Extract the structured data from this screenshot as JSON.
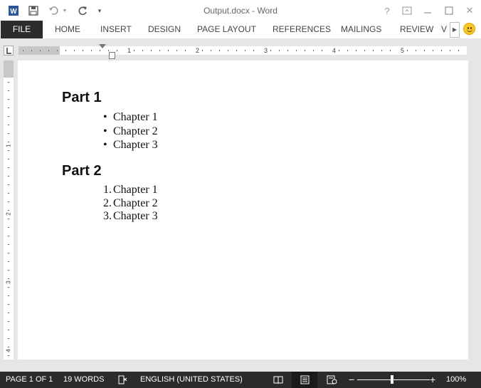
{
  "window": {
    "title": "Output.docx - Word",
    "help_label": "?",
    "minimize_label": "—",
    "close_label": "✕"
  },
  "quick_access": {
    "word_icon": "word-icon",
    "save_icon": "save-icon",
    "undo_icon": "undo-icon",
    "redo_icon": "redo-icon",
    "customize_icon": "customize-icon"
  },
  "ribbon": {
    "tabs": [
      {
        "label": "FILE"
      },
      {
        "label": "HOME"
      },
      {
        "label": "INSERT"
      },
      {
        "label": "DESIGN"
      },
      {
        "label": "PAGE LAYOUT"
      },
      {
        "label": "REFERENCES"
      },
      {
        "label": "MAILINGS"
      },
      {
        "label": "REVIEW"
      },
      {
        "label": "V"
      }
    ]
  },
  "ruler": {
    "h_numbers": [
      "1",
      "2",
      "3",
      "4",
      "5"
    ],
    "v_numbers": [
      "1",
      "2",
      "3",
      "4"
    ]
  },
  "document": {
    "part1": {
      "heading": "Part 1",
      "items": [
        "Chapter 1",
        "Chapter 2",
        "Chapter 3"
      ],
      "marker": "•"
    },
    "part2": {
      "heading": "Part 2",
      "items": [
        "Chapter 1",
        "Chapter 2",
        "Chapter 3"
      ],
      "markers": [
        "1.",
        "2.",
        "3."
      ]
    }
  },
  "status_bar": {
    "page": "PAGE 1 OF 1",
    "words": "19 WORDS",
    "language": "ENGLISH (UNITED STATES)",
    "zoom": "100%",
    "zoom_level": 100
  },
  "colors": {
    "file_tab_bg": "#2b2b2b",
    "status_bg": "#2b2b2b",
    "canvas_gray": "#e6e6e6"
  }
}
